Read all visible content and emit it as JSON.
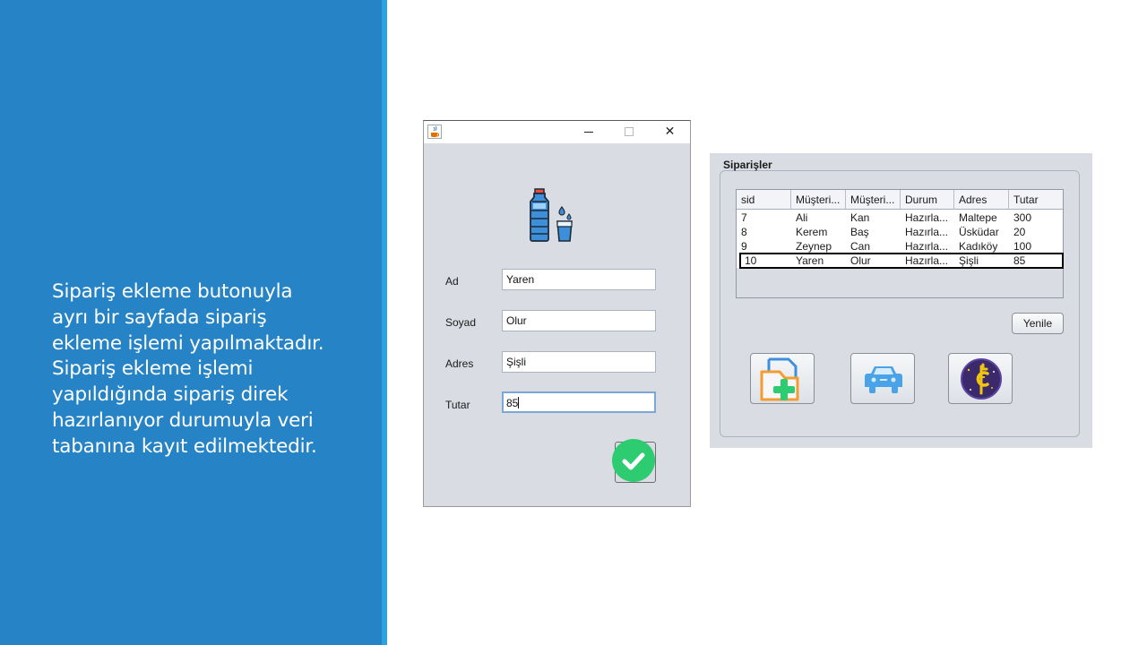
{
  "slide": {
    "text_lines": [
      "Sipariş ekleme butonuyla",
      "ayrı bir sayfada sipariş",
      "ekleme işlemi yapılmaktadır.",
      "Sipariş ekleme işlemi",
      "yapıldığında sipariş direk",
      "hazırlanıyor durumuyla veri",
      "tabanına kayıt edilmektedir."
    ],
    "colors": {
      "panel": "#2683c6",
      "stripe": "#2ba3e0"
    }
  },
  "add_window": {
    "icons": {
      "app": "java-cup-icon",
      "hero": "water-bottle-icon",
      "confirm": "checkmark-icon"
    },
    "titlebar": {
      "minimize": "minimize-icon",
      "maximize": "maximize-icon",
      "close": "✕"
    },
    "fields": [
      {
        "label": "Ad",
        "value": "Yaren"
      },
      {
        "label": "Soyad",
        "value": "Olur"
      },
      {
        "label": "Adres",
        "value": "Şişli"
      },
      {
        "label": "Tutar",
        "value": "85"
      }
    ],
    "focused_field": "Tutar",
    "colors": {
      "confirm": "#2ecc71"
    }
  },
  "orders_panel": {
    "title": "Siparişler",
    "columns": [
      "sid",
      "Müşteri...",
      "Müşteri...",
      "Durum",
      "Adres",
      "Tutar"
    ],
    "rows": [
      [
        "7",
        "Ali",
        "Kan",
        "Hazırla...",
        "Maltepe",
        "300"
      ],
      [
        "8",
        "Kerem",
        "Baş",
        "Hazırla...",
        "Üsküdar",
        "20"
      ],
      [
        "9",
        "Zeynep",
        "Can",
        "Hazırla...",
        "Kadıköy",
        "100"
      ],
      [
        "10",
        "Yaren",
        "Olur",
        "Hazırla...",
        "Şişli",
        "85"
      ]
    ],
    "selected_row": "10",
    "refresh_label": "Yenile",
    "action_icons": [
      "add-order-icon",
      "delivery-car-icon",
      "bitcoin-payment-icon"
    ]
  }
}
